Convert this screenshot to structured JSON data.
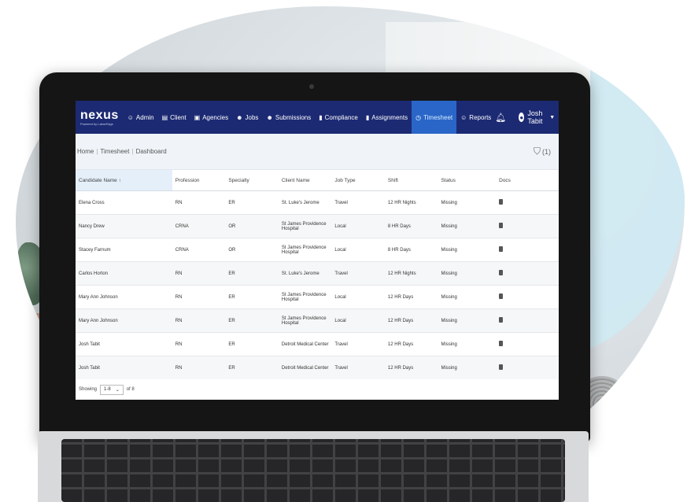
{
  "nav": {
    "logo": "nexus",
    "logo_tagline": "Powered by LaborEdge",
    "items": [
      {
        "label": "Admin",
        "icon": "person-icon"
      },
      {
        "label": "Client",
        "icon": "building-icon"
      },
      {
        "label": "Agencies",
        "icon": "briefcase-icon"
      },
      {
        "label": "Jobs",
        "icon": "people-icon"
      },
      {
        "label": "Submissions",
        "icon": "people-icon"
      },
      {
        "label": "Compliance",
        "icon": "document-icon"
      },
      {
        "label": "Assignments",
        "icon": "document-icon"
      },
      {
        "label": "Timesheet",
        "icon": "clock-icon",
        "active": true
      },
      {
        "label": "Reports",
        "icon": "person-icon"
      }
    ],
    "user_name": "Josh Tabit"
  },
  "breadcrumb": [
    "Home",
    "Timesheet",
    "Dashboard"
  ],
  "filter_count": "(1)",
  "table": {
    "columns": [
      "Candidate Name",
      "Profession",
      "Specialty",
      "Client Name",
      "Job Type",
      "Shift",
      "Status",
      "Docs"
    ],
    "sort_indicator": "↑",
    "rows": [
      [
        "Elena Cross",
        "RN",
        "ER",
        "St. Luke's Jerome",
        "Travel",
        "12 HR Nights",
        "Missing"
      ],
      [
        "Nancy Drew",
        "CRNA",
        "OR",
        "St James Providence Hospital",
        "Local",
        "8 HR Days",
        "Missing"
      ],
      [
        "Stacey Farnum",
        "CRNA",
        "OR",
        "St James Providence Hospital",
        "Local",
        "8 HR Days",
        "Missing"
      ],
      [
        "Carlos Horton",
        "RN",
        "ER",
        "St. Luke's Jerome",
        "Travel",
        "12 HR Nights",
        "Missing"
      ],
      [
        "Mary Ann Johnson",
        "RN",
        "ER",
        "St James Providence Hospital",
        "Local",
        "12 HR Days",
        "Missing"
      ],
      [
        "Mary Ann Johnson",
        "RN",
        "ER",
        "St James Providence Hospital",
        "Local",
        "12 HR Days",
        "Missing"
      ],
      [
        "Josh Tabit",
        "RN",
        "ER",
        "Detroit Medical Center",
        "Travel",
        "12 HR Days",
        "Missing"
      ],
      [
        "Josh Tabit",
        "RN",
        "ER",
        "Detroit Medical Center",
        "Travel",
        "12 HR Days",
        "Missing"
      ]
    ]
  },
  "footer": {
    "showing_label": "Showing",
    "range": "1-8",
    "of_label": "of 8"
  }
}
